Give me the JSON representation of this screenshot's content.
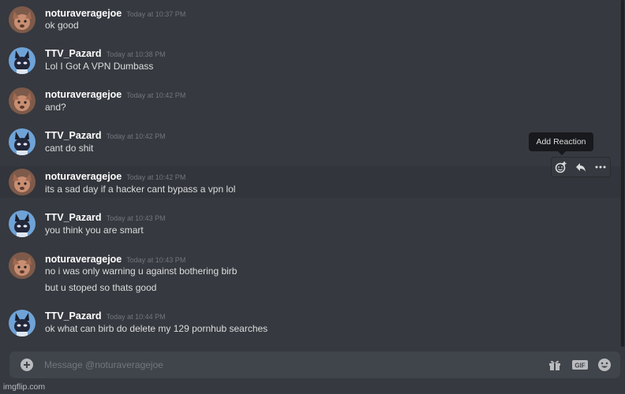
{
  "messages": [
    {
      "user": "noturaveragejoe",
      "time": "Today at 10:37 PM",
      "lines": [
        "ok good"
      ]
    },
    {
      "user": "TTV_Pazard",
      "time": "Today at 10:38 PM",
      "lines": [
        "Lol I Got A VPN Dumbass"
      ]
    },
    {
      "user": "noturaveragejoe",
      "time": "Today at 10:42 PM",
      "lines": [
        "and?"
      ]
    },
    {
      "user": "TTV_Pazard",
      "time": "Today at 10:42 PM",
      "lines": [
        "cant do shit"
      ]
    },
    {
      "user": "noturaveragejoe",
      "time": "Today at 10:42 PM",
      "lines": [
        "its a sad day if a hacker cant bypass a vpn lol"
      ]
    },
    {
      "user": "TTV_Pazard",
      "time": "Today at 10:43 PM",
      "lines": [
        "you think you are smart"
      ]
    },
    {
      "user": "noturaveragejoe",
      "time": "Today at 10:43 PM",
      "lines": [
        "no i was only warning u against bothering birb",
        "but u stoped so thats good"
      ]
    },
    {
      "user": "TTV_Pazard",
      "time": "Today at 10:44 PM",
      "lines": [
        "ok what can birb do delete my 129 pornhub searches"
      ]
    }
  ],
  "hover_toolbar": {
    "tooltip": "Add Reaction",
    "icons": [
      "add-reaction-icon",
      "reply-icon",
      "more-icon"
    ]
  },
  "composer": {
    "placeholder": "Message @noturaveragejoe",
    "icons": [
      "add-attachment-icon",
      "gift-icon",
      "gif-icon",
      "emoji-icon"
    ],
    "gif_label": "GIF"
  },
  "watermark": "imgflip.com",
  "colors": {
    "background": "#36393f",
    "username": "#ffffff",
    "timestamp": "#72767d",
    "input_bg": "#40444b"
  }
}
